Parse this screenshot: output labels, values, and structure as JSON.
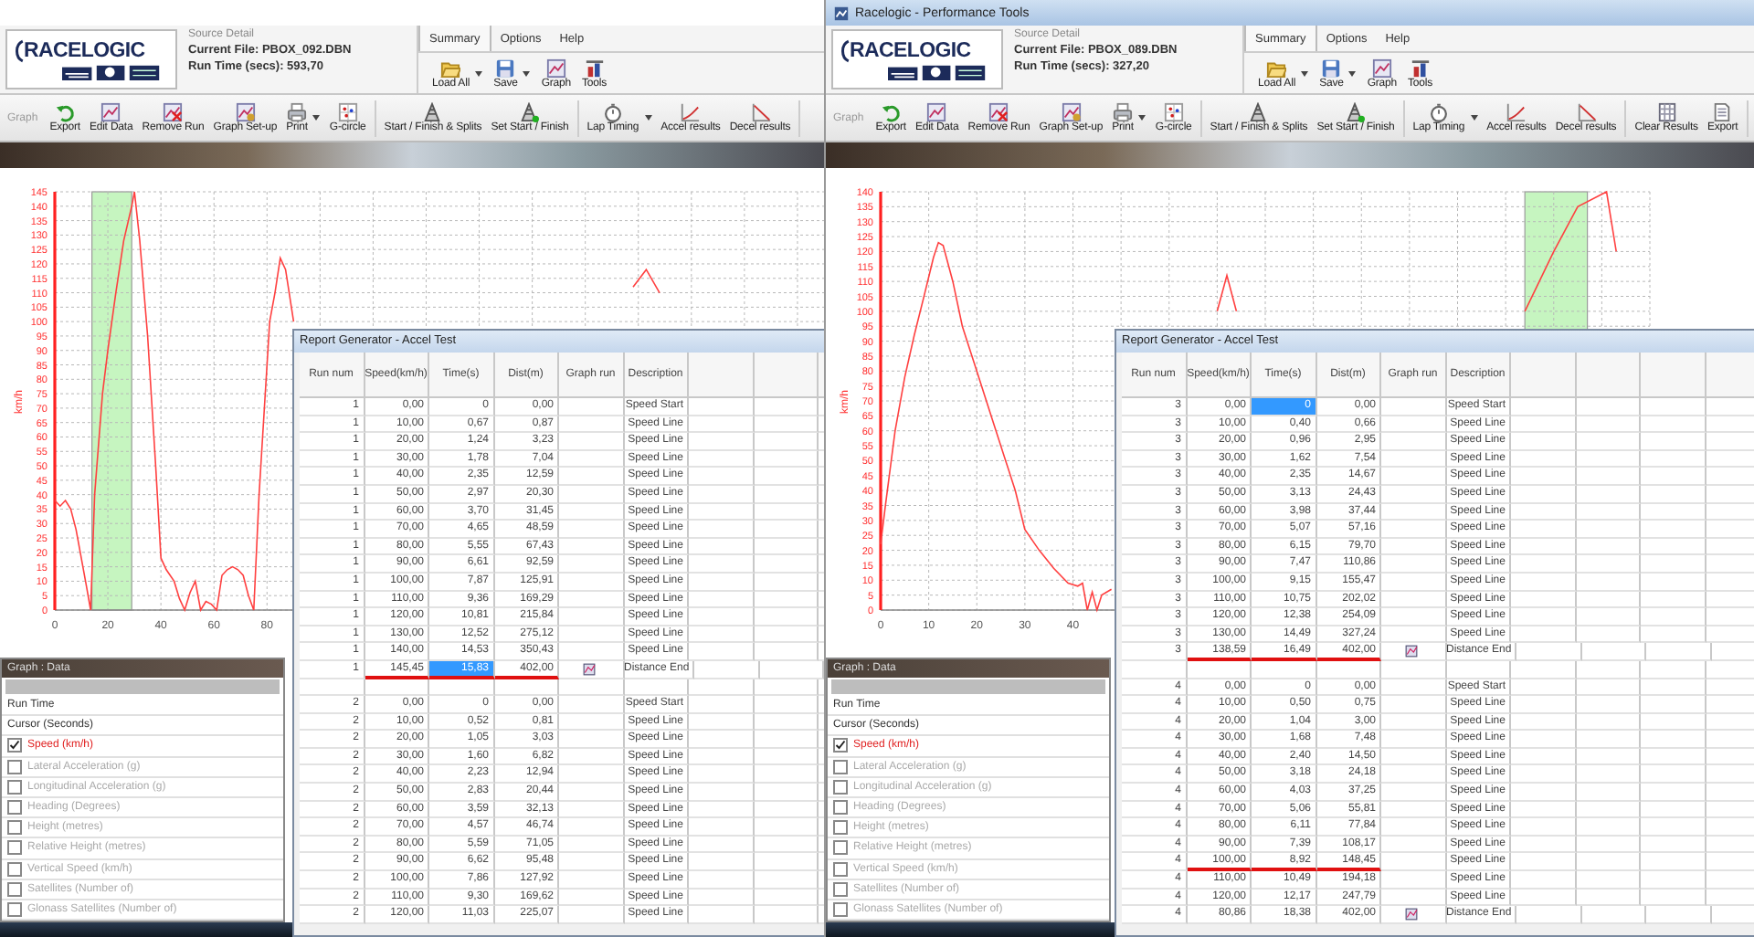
{
  "windows": [
    {
      "logo": {
        "text": "RACELOGIC"
      },
      "source_detail": {
        "heading": "Source Detail",
        "current_file": "Current File: PBOX_092.DBN",
        "run_time": "Run Time (secs): 593,70"
      },
      "menu_tabs": [
        {
          "label": "Summary",
          "selected": true
        },
        {
          "label": "Options",
          "selected": false
        },
        {
          "label": "Help",
          "selected": false
        }
      ],
      "toolbar": [
        {
          "kind": "load",
          "label": "Load All",
          "dropdown": true
        },
        {
          "kind": "save",
          "label": "Save",
          "dropdown": true
        },
        {
          "kind": "graph",
          "label": "Graph",
          "dropdown": false
        },
        {
          "kind": "tools",
          "label": "Tools",
          "dropdown": false
        }
      ],
      "ribbon": {
        "label": "Graph",
        "groups": [
          [
            {
              "kind": "export",
              "label": "Export",
              "dropdown": false
            },
            {
              "kind": "edit",
              "label": "Edit Data",
              "dropdown": false
            },
            {
              "kind": "remove",
              "label": "Remove Run",
              "dropdown": false
            },
            {
              "kind": "setup",
              "label": "Graph Set-up",
              "dropdown": false
            },
            {
              "kind": "print",
              "label": "Print",
              "dropdown": true
            },
            {
              "kind": "gcircle",
              "label": "G-circle",
              "dropdown": false
            }
          ],
          [
            {
              "kind": "splits",
              "label": "Start / Finish & Splits",
              "dropdown": false
            },
            {
              "kind": "setstart",
              "label": "Set Start / Finish",
              "dropdown": false
            }
          ],
          [
            {
              "kind": "lap",
              "label": "Lap Timing",
              "dropdown": true
            },
            {
              "kind": "accel",
              "label": "Accel results",
              "dropdown": false
            },
            {
              "kind": "decel",
              "label": "Decel results",
              "dropdown": false
            }
          ]
        ]
      },
      "chart_data": {
        "type": "line",
        "ylabel": "km/h",
        "xlim": [
          0,
          290
        ],
        "ylim": [
          0,
          145
        ],
        "xticks": [
          0,
          20,
          40,
          60,
          80
        ],
        "yticks": [
          0,
          5,
          10,
          15,
          20,
          25,
          30,
          35,
          40,
          45,
          50,
          55,
          60,
          65,
          70,
          75,
          80,
          85,
          90,
          95,
          100,
          105,
          110,
          115,
          120,
          125,
          130,
          135,
          140,
          145
        ],
        "x": [
          0,
          2,
          4,
          6,
          8,
          10,
          12,
          13.5,
          15,
          18,
          20,
          23,
          26,
          29,
          30,
          32,
          35,
          38,
          40,
          42,
          45,
          47,
          49,
          51,
          53,
          55,
          57,
          59,
          61,
          63,
          65,
          67,
          69,
          71,
          73,
          75,
          77,
          79,
          81,
          83,
          85,
          87,
          90,
          95,
          100,
          120,
          150,
          180,
          200,
          212,
          218,
          223,
          228
        ],
        "values": [
          38,
          36,
          38,
          35,
          28,
          18,
          8,
          0,
          40,
          75,
          90,
          110,
          128,
          140,
          145,
          128,
          95,
          50,
          18,
          14,
          10,
          4,
          0,
          6,
          10,
          0,
          3,
          2,
          0,
          12,
          14,
          15,
          14,
          12,
          5,
          0,
          40,
          70,
          100,
          110,
          122,
          118,
          100,
          null,
          null,
          null,
          null,
          null,
          null,
          null,
          112,
          118,
          110
        ],
        "grid": true,
        "bands": [
          {
            "axis": "x",
            "from": 14,
            "to": 29
          }
        ]
      },
      "graph_data_panel": {
        "title": "Graph : Data",
        "rows": [
          "Run Time",
          "Cursor (Seconds)"
        ],
        "channels": [
          {
            "label": "Speed (km/h)",
            "checked": true
          },
          {
            "label": "Lateral Acceleration (g)",
            "checked": false
          },
          {
            "label": "Longitudinal Acceleration (g)",
            "checked": false
          },
          {
            "label": "Heading (Degrees)",
            "checked": false
          },
          {
            "label": "Height (metres)",
            "checked": false
          },
          {
            "label": "Relative Height (metres)",
            "checked": false
          },
          {
            "label": "Vertical Speed (km/h)",
            "checked": false
          },
          {
            "label": "Satellites (Number of)",
            "checked": false
          },
          {
            "label": "Glonass Satellites (Number of)",
            "checked": false
          }
        ]
      },
      "report": {
        "title": "Report Generator - Accel Test",
        "columns": [
          "Run num",
          "Speed(km/h)",
          "Time(s)",
          "Dist(m)",
          "Graph run",
          "Description"
        ],
        "runs": [
          {
            "rows": [
              {
                "run": "1",
                "speed": "0,00",
                "time": "0",
                "dist": "0,00",
                "description": "Speed Start",
                "graph_icon": false,
                "underlined": false,
                "time_selected": false
              },
              {
                "run": "1",
                "speed": "10,00",
                "time": "0,67",
                "dist": "0,87",
                "description": "Speed Line",
                "graph_icon": false,
                "underlined": false,
                "time_selected": false
              },
              {
                "run": "1",
                "speed": "20,00",
                "time": "1,24",
                "dist": "3,23",
                "description": "Speed Line",
                "graph_icon": false,
                "underlined": false,
                "time_selected": false
              },
              {
                "run": "1",
                "speed": "30,00",
                "time": "1,78",
                "dist": "7,04",
                "description": "Speed Line",
                "graph_icon": false,
                "underlined": false,
                "time_selected": false
              },
              {
                "run": "1",
                "speed": "40,00",
                "time": "2,35",
                "dist": "12,59",
                "description": "Speed Line",
                "graph_icon": false,
                "underlined": false,
                "time_selected": false
              },
              {
                "run": "1",
                "speed": "50,00",
                "time": "2,97",
                "dist": "20,30",
                "description": "Speed Line",
                "graph_icon": false,
                "underlined": false,
                "time_selected": false
              },
              {
                "run": "1",
                "speed": "60,00",
                "time": "3,70",
                "dist": "31,45",
                "description": "Speed Line",
                "graph_icon": false,
                "underlined": false,
                "time_selected": false
              },
              {
                "run": "1",
                "speed": "70,00",
                "time": "4,65",
                "dist": "48,59",
                "description": "Speed Line",
                "graph_icon": false,
                "underlined": false,
                "time_selected": false
              },
              {
                "run": "1",
                "speed": "80,00",
                "time": "5,55",
                "dist": "67,43",
                "description": "Speed Line",
                "graph_icon": false,
                "underlined": false,
                "time_selected": false
              },
              {
                "run": "1",
                "speed": "90,00",
                "time": "6,61",
                "dist": "92,59",
                "description": "Speed Line",
                "graph_icon": false,
                "underlined": false,
                "time_selected": false
              },
              {
                "run": "1",
                "speed": "100,00",
                "time": "7,87",
                "dist": "125,91",
                "description": "Speed Line",
                "graph_icon": false,
                "underlined": false,
                "time_selected": false
              },
              {
                "run": "1",
                "speed": "110,00",
                "time": "9,36",
                "dist": "169,29",
                "description": "Speed Line",
                "graph_icon": false,
                "underlined": false,
                "time_selected": false
              },
              {
                "run": "1",
                "speed": "120,00",
                "time": "10,81",
                "dist": "215,84",
                "description": "Speed Line",
                "graph_icon": false,
                "underlined": false,
                "time_selected": false
              },
              {
                "run": "1",
                "speed": "130,00",
                "time": "12,52",
                "dist": "275,12",
                "description": "Speed Line",
                "graph_icon": false,
                "underlined": false,
                "time_selected": false
              },
              {
                "run": "1",
                "speed": "140,00",
                "time": "14,53",
                "dist": "350,43",
                "description": "Speed Line",
                "graph_icon": false,
                "underlined": false,
                "time_selected": false
              },
              {
                "run": "1",
                "speed": "145,45",
                "time": "15,83",
                "dist": "402,00",
                "description": "Distance End",
                "graph_icon": true,
                "underlined": true,
                "time_selected": true
              }
            ]
          },
          {
            "rows": [
              {
                "run": "2",
                "speed": "0,00",
                "time": "0",
                "dist": "0,00",
                "description": "Speed Start",
                "graph_icon": false,
                "underlined": false,
                "time_selected": false
              },
              {
                "run": "2",
                "speed": "10,00",
                "time": "0,52",
                "dist": "0,81",
                "description": "Speed Line",
                "graph_icon": false,
                "underlined": false,
                "time_selected": false
              },
              {
                "run": "2",
                "speed": "20,00",
                "time": "1,05",
                "dist": "3,03",
                "description": "Speed Line",
                "graph_icon": false,
                "underlined": false,
                "time_selected": false
              },
              {
                "run": "2",
                "speed": "30,00",
                "time": "1,60",
                "dist": "6,82",
                "description": "Speed Line",
                "graph_icon": false,
                "underlined": false,
                "time_selected": false
              },
              {
                "run": "2",
                "speed": "40,00",
                "time": "2,23",
                "dist": "12,94",
                "description": "Speed Line",
                "graph_icon": false,
                "underlined": false,
                "time_selected": false
              },
              {
                "run": "2",
                "speed": "50,00",
                "time": "2,83",
                "dist": "20,44",
                "description": "Speed Line",
                "graph_icon": false,
                "underlined": false,
                "time_selected": false
              },
              {
                "run": "2",
                "speed": "60,00",
                "time": "3,59",
                "dist": "32,13",
                "description": "Speed Line",
                "graph_icon": false,
                "underlined": false,
                "time_selected": false
              },
              {
                "run": "2",
                "speed": "70,00",
                "time": "4,57",
                "dist": "46,74",
                "description": "Speed Line",
                "graph_icon": false,
                "underlined": false,
                "time_selected": false
              },
              {
                "run": "2",
                "speed": "80,00",
                "time": "5,59",
                "dist": "71,05",
                "description": "Speed Line",
                "graph_icon": false,
                "underlined": false,
                "time_selected": false
              },
              {
                "run": "2",
                "speed": "90,00",
                "time": "6,62",
                "dist": "95,48",
                "description": "Speed Line",
                "graph_icon": false,
                "underlined": false,
                "time_selected": false
              },
              {
                "run": "2",
                "speed": "100,00",
                "time": "7,86",
                "dist": "127,92",
                "description": "Speed Line",
                "graph_icon": false,
                "underlined": false,
                "time_selected": false
              },
              {
                "run": "2",
                "speed": "110,00",
                "time": "9,30",
                "dist": "169,62",
                "description": "Speed Line",
                "graph_icon": false,
                "underlined": false,
                "time_selected": false
              },
              {
                "run": "2",
                "speed": "120,00",
                "time": "11,03",
                "dist": "225,07",
                "description": "Speed Line",
                "graph_icon": false,
                "underlined": false,
                "time_selected": false
              }
            ]
          }
        ]
      }
    },
    {
      "title": "Racelogic - Performance Tools",
      "logo": {
        "text": "RACELOGIC"
      },
      "source_detail": {
        "heading": "Source Detail",
        "current_file": "Current File: PBOX_089.DBN",
        "run_time": "Run Time (secs): 327,20"
      },
      "menu_tabs": [
        {
          "label": "Summary",
          "selected": true
        },
        {
          "label": "Options",
          "selected": false
        },
        {
          "label": "Help",
          "selected": false
        }
      ],
      "toolbar": [
        {
          "kind": "load",
          "label": "Load All",
          "dropdown": true
        },
        {
          "kind": "save",
          "label": "Save",
          "dropdown": true
        },
        {
          "kind": "graph",
          "label": "Graph",
          "dropdown": false
        },
        {
          "kind": "tools",
          "label": "Tools",
          "dropdown": false
        }
      ],
      "ribbon": {
        "label": "Graph",
        "groups": [
          [
            {
              "kind": "export",
              "label": "Export",
              "dropdown": false
            },
            {
              "kind": "edit",
              "label": "Edit Data",
              "dropdown": false
            },
            {
              "kind": "remove",
              "label": "Remove Run",
              "dropdown": false
            },
            {
              "kind": "setup",
              "label": "Graph Set-up",
              "dropdown": false
            },
            {
              "kind": "print",
              "label": "Print",
              "dropdown": true
            },
            {
              "kind": "gcircle",
              "label": "G-circle",
              "dropdown": false
            }
          ],
          [
            {
              "kind": "splits",
              "label": "Start / Finish & Splits",
              "dropdown": false
            },
            {
              "kind": "setstart",
              "label": "Set Start / Finish",
              "dropdown": false
            }
          ],
          [
            {
              "kind": "lap",
              "label": "Lap Timing",
              "dropdown": true
            },
            {
              "kind": "accel",
              "label": "Accel results",
              "dropdown": false
            },
            {
              "kind": "decel",
              "label": "Decel results",
              "dropdown": false
            }
          ],
          [
            {
              "kind": "clear",
              "label": "Clear Results",
              "dropdown": false
            },
            {
              "kind": "report",
              "label": "Export",
              "dropdown": false
            }
          ]
        ]
      },
      "chart_data": {
        "type": "line",
        "ylabel": "km/h",
        "xlim": [
          0,
          160
        ],
        "ylim": [
          0,
          140
        ],
        "xticks": [
          0,
          10,
          20,
          30,
          40
        ],
        "yticks": [
          0,
          5,
          10,
          15,
          20,
          25,
          30,
          35,
          40,
          45,
          50,
          55,
          60,
          65,
          70,
          75,
          80,
          85,
          90,
          95,
          100,
          105,
          110,
          115,
          120,
          125,
          130,
          135,
          140
        ],
        "x": [
          0,
          1,
          3,
          5,
          7,
          9,
          11,
          12,
          13,
          15,
          17,
          20,
          23,
          26,
          28,
          30,
          33,
          36,
          39,
          41,
          42,
          43,
          44,
          45,
          46,
          48,
          55,
          65,
          70,
          72,
          74,
          80,
          100,
          120,
          130,
          134,
          140,
          145,
          151,
          153
        ],
        "values": [
          22,
          35,
          60,
          78,
          92,
          105,
          118,
          123,
          122,
          110,
          95,
          80,
          65,
          50,
          40,
          27,
          20,
          14,
          9,
          8,
          9,
          0,
          6,
          0,
          5,
          7,
          null,
          null,
          100,
          112,
          100,
          null,
          null,
          null,
          null,
          100,
          120,
          135,
          140,
          120
        ],
        "grid": true,
        "bands": [
          {
            "axis": "x",
            "from": 134,
            "to": 147
          }
        ]
      },
      "graph_data_panel": {
        "title": "Graph : Data",
        "rows": [
          "Run Time",
          "Cursor (Seconds)"
        ],
        "channels": [
          {
            "label": "Speed (km/h)",
            "checked": true
          },
          {
            "label": "Lateral Acceleration (g)",
            "checked": false
          },
          {
            "label": "Longitudinal Acceleration (g)",
            "checked": false
          },
          {
            "label": "Heading (Degrees)",
            "checked": false
          },
          {
            "label": "Height (metres)",
            "checked": false
          },
          {
            "label": "Relative Height (metres)",
            "checked": false
          },
          {
            "label": "Vertical Speed (km/h)",
            "checked": false
          },
          {
            "label": "Satellites (Number of)",
            "checked": false
          },
          {
            "label": "Glonass Satellites (Number of)",
            "checked": false
          }
        ]
      },
      "report": {
        "title": "Report Generator - Accel Test",
        "columns": [
          "Run num",
          "Speed(km/h)",
          "Time(s)",
          "Dist(m)",
          "Graph run",
          "Description"
        ],
        "runs": [
          {
            "rows": [
              {
                "run": "3",
                "speed": "0,00",
                "time": "0",
                "dist": "0,00",
                "description": "Speed Start",
                "graph_icon": false,
                "underlined": false,
                "time_selected": true
              },
              {
                "run": "3",
                "speed": "10,00",
                "time": "0,40",
                "dist": "0,66",
                "description": "Speed Line",
                "graph_icon": false,
                "underlined": false,
                "time_selected": false
              },
              {
                "run": "3",
                "speed": "20,00",
                "time": "0,96",
                "dist": "2,95",
                "description": "Speed Line",
                "graph_icon": false,
                "underlined": false,
                "time_selected": false
              },
              {
                "run": "3",
                "speed": "30,00",
                "time": "1,62",
                "dist": "7,54",
                "description": "Speed Line",
                "graph_icon": false,
                "underlined": false,
                "time_selected": false
              },
              {
                "run": "3",
                "speed": "40,00",
                "time": "2,35",
                "dist": "14,67",
                "description": "Speed Line",
                "graph_icon": false,
                "underlined": false,
                "time_selected": false
              },
              {
                "run": "3",
                "speed": "50,00",
                "time": "3,13",
                "dist": "24,43",
                "description": "Speed Line",
                "graph_icon": false,
                "underlined": false,
                "time_selected": false
              },
              {
                "run": "3",
                "speed": "60,00",
                "time": "3,98",
                "dist": "37,44",
                "description": "Speed Line",
                "graph_icon": false,
                "underlined": false,
                "time_selected": false
              },
              {
                "run": "3",
                "speed": "70,00",
                "time": "5,07",
                "dist": "57,16",
                "description": "Speed Line",
                "graph_icon": false,
                "underlined": false,
                "time_selected": false
              },
              {
                "run": "3",
                "speed": "80,00",
                "time": "6,15",
                "dist": "79,70",
                "description": "Speed Line",
                "graph_icon": false,
                "underlined": false,
                "time_selected": false
              },
              {
                "run": "3",
                "speed": "90,00",
                "time": "7,47",
                "dist": "110,86",
                "description": "Speed Line",
                "graph_icon": false,
                "underlined": false,
                "time_selected": false
              },
              {
                "run": "3",
                "speed": "100,00",
                "time": "9,15",
                "dist": "155,47",
                "description": "Speed Line",
                "graph_icon": false,
                "underlined": false,
                "time_selected": false
              },
              {
                "run": "3",
                "speed": "110,00",
                "time": "10,75",
                "dist": "202,02",
                "description": "Speed Line",
                "graph_icon": false,
                "underlined": false,
                "time_selected": false
              },
              {
                "run": "3",
                "speed": "120,00",
                "time": "12,38",
                "dist": "254,09",
                "description": "Speed Line",
                "graph_icon": false,
                "underlined": false,
                "time_selected": false
              },
              {
                "run": "3",
                "speed": "130,00",
                "time": "14,49",
                "dist": "327,24",
                "description": "Speed Line",
                "graph_icon": false,
                "underlined": false,
                "time_selected": false
              },
              {
                "run": "3",
                "speed": "138,59",
                "time": "16,49",
                "dist": "402,00",
                "description": "Distance End",
                "graph_icon": true,
                "underlined": true,
                "time_selected": false
              }
            ]
          },
          {
            "rows": [
              {
                "run": "4",
                "speed": "0,00",
                "time": "0",
                "dist": "0,00",
                "description": "Speed Start",
                "graph_icon": false,
                "underlined": false,
                "time_selected": false
              },
              {
                "run": "4",
                "speed": "10,00",
                "time": "0,50",
                "dist": "0,75",
                "description": "Speed Line",
                "graph_icon": false,
                "underlined": false,
                "time_selected": false
              },
              {
                "run": "4",
                "speed": "20,00",
                "time": "1,04",
                "dist": "3,00",
                "description": "Speed Line",
                "graph_icon": false,
                "underlined": false,
                "time_selected": false
              },
              {
                "run": "4",
                "speed": "30,00",
                "time": "1,68",
                "dist": "7,48",
                "description": "Speed Line",
                "graph_icon": false,
                "underlined": false,
                "time_selected": false
              },
              {
                "run": "4",
                "speed": "40,00",
                "time": "2,40",
                "dist": "14,50",
                "description": "Speed Line",
                "graph_icon": false,
                "underlined": false,
                "time_selected": false
              },
              {
                "run": "4",
                "speed": "50,00",
                "time": "3,18",
                "dist": "24,18",
                "description": "Speed Line",
                "graph_icon": false,
                "underlined": false,
                "time_selected": false
              },
              {
                "run": "4",
                "speed": "60,00",
                "time": "4,03",
                "dist": "37,25",
                "description": "Speed Line",
                "graph_icon": false,
                "underlined": false,
                "time_selected": false
              },
              {
                "run": "4",
                "speed": "70,00",
                "time": "5,06",
                "dist": "55,81",
                "description": "Speed Line",
                "graph_icon": false,
                "underlined": false,
                "time_selected": false
              },
              {
                "run": "4",
                "speed": "80,00",
                "time": "6,11",
                "dist": "77,84",
                "description": "Speed Line",
                "graph_icon": false,
                "underlined": false,
                "time_selected": false
              },
              {
                "run": "4",
                "speed": "90,00",
                "time": "7,39",
                "dist": "108,17",
                "description": "Speed Line",
                "graph_icon": false,
                "underlined": false,
                "time_selected": false
              },
              {
                "run": "4",
                "speed": "100,00",
                "time": "8,92",
                "dist": "148,45",
                "description": "Speed Line",
                "graph_icon": false,
                "underlined": true,
                "time_selected": false
              },
              {
                "run": "4",
                "speed": "110,00",
                "time": "10,49",
                "dist": "194,18",
                "description": "Speed Line",
                "graph_icon": false,
                "underlined": false,
                "time_selected": false
              },
              {
                "run": "4",
                "speed": "120,00",
                "time": "12,17",
                "dist": "247,79",
                "description": "Speed Line",
                "graph_icon": false,
                "underlined": false,
                "time_selected": false
              },
              {
                "run": "4",
                "speed": "80,86",
                "time": "18,38",
                "dist": "402,00",
                "description": "Distance End",
                "graph_icon": true,
                "underlined": false,
                "time_selected": false
              }
            ]
          }
        ]
      }
    }
  ]
}
